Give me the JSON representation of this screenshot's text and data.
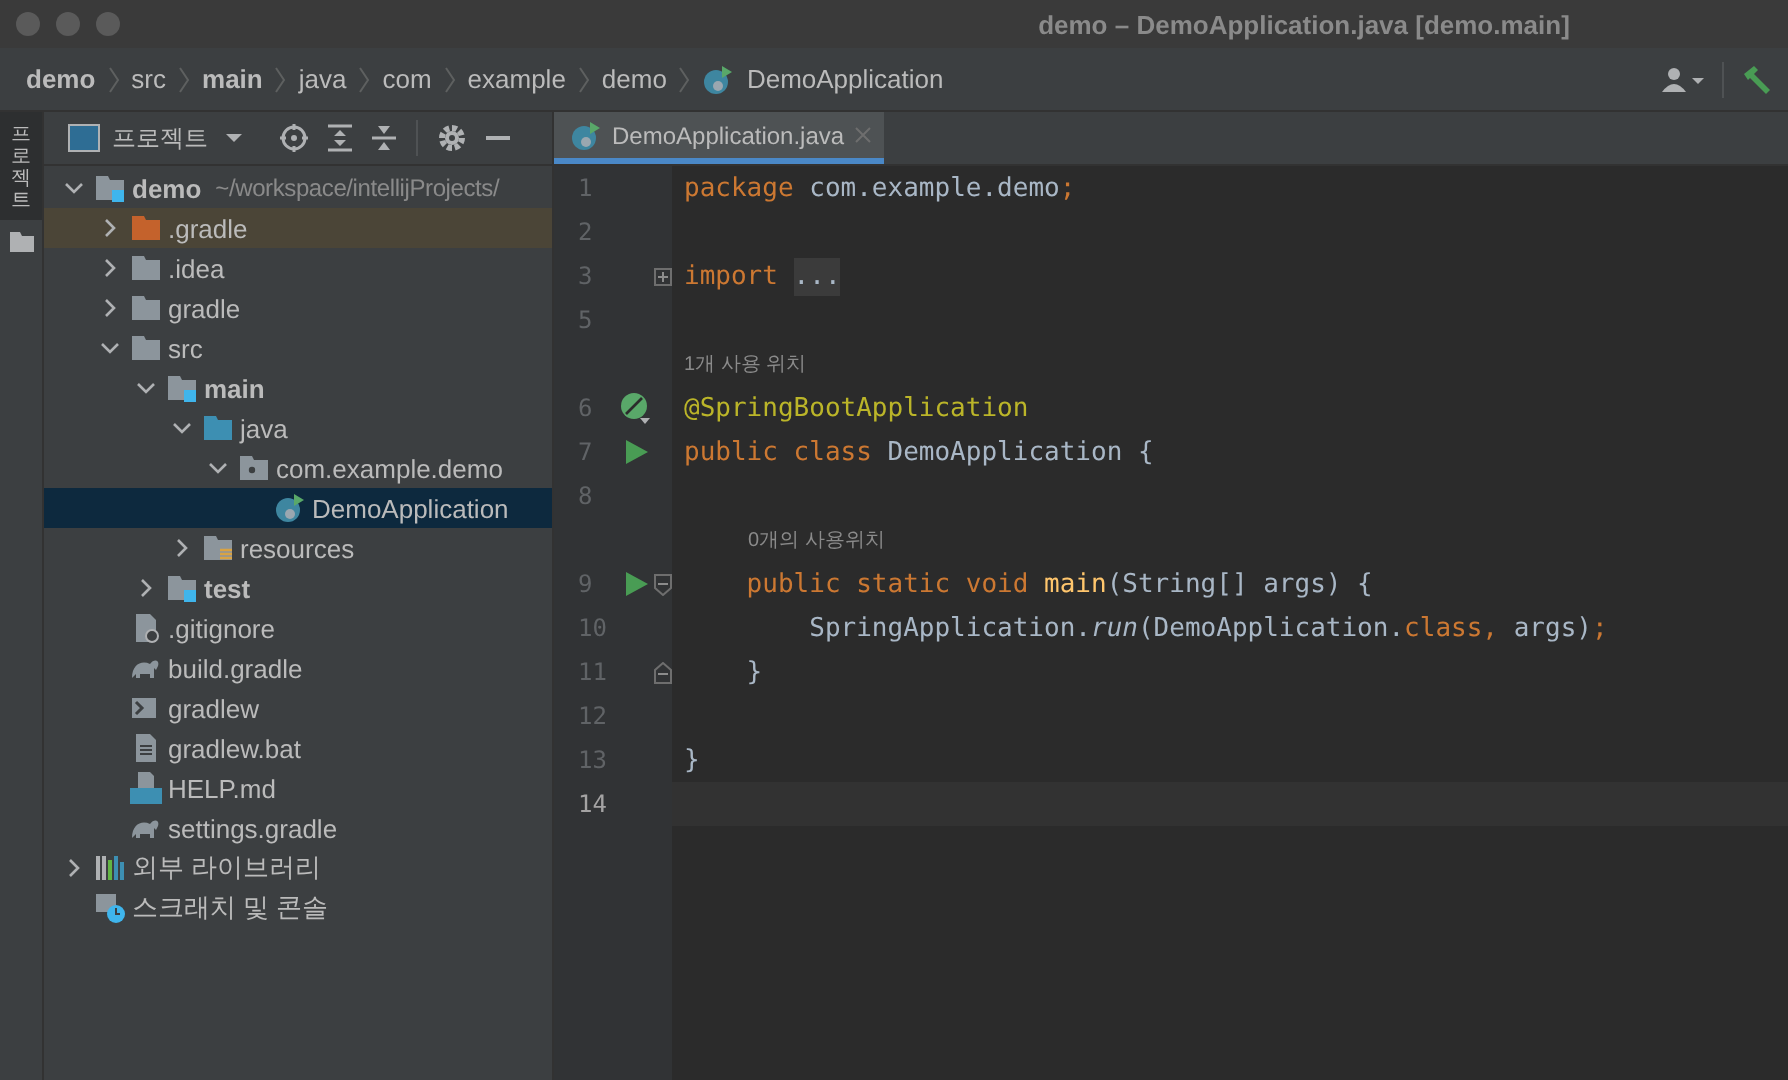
{
  "window": {
    "title": "demo – DemoApplication.java [demo.main]"
  },
  "breadcrumbs": [
    {
      "label": "demo",
      "bold": true,
      "kind": "directory"
    },
    {
      "label": "src",
      "bold": false,
      "kind": "directory"
    },
    {
      "label": "main",
      "bold": true,
      "kind": "directory"
    },
    {
      "label": "java",
      "bold": false,
      "kind": "directory"
    },
    {
      "label": "com",
      "bold": false,
      "kind": "directory"
    },
    {
      "label": "example",
      "bold": false,
      "kind": "directory"
    },
    {
      "label": "demo",
      "bold": false,
      "kind": "directory"
    },
    {
      "label": "DemoApplication",
      "bold": false,
      "kind": "spring-class"
    }
  ],
  "side_tab": {
    "label": "프로젝트",
    "selected": true
  },
  "project_toolbar": {
    "view": "프로젝트"
  },
  "tree": [
    {
      "label": "demo",
      "hint": "~/workspace/intellijProjects/",
      "kind": "folder-module",
      "bold": true,
      "expanded": true,
      "selected": false,
      "children": [
        {
          "label": ".gradle",
          "kind": "folder-excluded",
          "bold": false,
          "expanded": false,
          "selected": false
        },
        {
          "label": ".idea",
          "kind": "folder",
          "bold": false,
          "expanded": false,
          "selected": false
        },
        {
          "label": "gradle",
          "kind": "folder",
          "bold": false,
          "expanded": false,
          "selected": false
        },
        {
          "label": "src",
          "kind": "folder",
          "bold": false,
          "expanded": true,
          "selected": false,
          "children": [
            {
              "label": "main",
              "kind": "folder-module",
              "bold": true,
              "expanded": true,
              "selected": false,
              "children": [
                {
                  "label": "java",
                  "kind": "folder-source",
                  "bold": false,
                  "expanded": true,
                  "selected": false,
                  "children": [
                    {
                      "label": "com.example.demo",
                      "kind": "package",
                      "bold": false,
                      "expanded": true,
                      "selected": false,
                      "children": [
                        {
                          "label": "DemoApplication",
                          "kind": "spring-class",
                          "bold": false,
                          "selected": true
                        }
                      ]
                    }
                  ]
                },
                {
                  "label": "resources",
                  "kind": "folder-resources",
                  "bold": false,
                  "expanded": false,
                  "selected": false
                }
              ]
            },
            {
              "label": "test",
              "kind": "folder-module",
              "bold": true,
              "expanded": false,
              "selected": false
            }
          ]
        },
        {
          "label": ".gitignore",
          "kind": "file-ignore",
          "bold": false,
          "selected": false
        },
        {
          "label": "build.gradle",
          "kind": "gradle",
          "bold": false,
          "selected": false
        },
        {
          "label": "gradlew",
          "kind": "shell",
          "bold": false,
          "selected": false
        },
        {
          "label": "gradlew.bat",
          "kind": "text-file",
          "bold": false,
          "selected": false
        },
        {
          "label": "HELP.md",
          "kind": "markdown",
          "bold": false,
          "selected": false
        },
        {
          "label": "settings.gradle",
          "kind": "gradle",
          "bold": false,
          "selected": false
        }
      ]
    },
    {
      "label": "외부 라이브러리",
      "kind": "library",
      "bold": false,
      "expanded": false,
      "selected": false
    },
    {
      "label": "스크래치 및 콘솔",
      "kind": "scratch",
      "bold": false,
      "selected": false
    }
  ],
  "editor_tab": {
    "label": "DemoApplication.java",
    "selected": true,
    "kind": "spring-class"
  },
  "code": [
    {
      "kind": "code",
      "number": "1",
      "current": false,
      "tokens": [
        {
          "text": "package",
          "kind": "keyword"
        },
        {
          "text": " com.example.demo",
          "kind": "plain"
        },
        {
          "text": ";",
          "kind": "keyword"
        }
      ]
    },
    {
      "kind": "code",
      "number": "2",
      "current": false
    },
    {
      "kind": "code",
      "number": "3",
      "current": false,
      "gutter": [
        {
          "kind": "fold-collapsed"
        }
      ],
      "tokens": [
        {
          "text": "import ",
          "kind": "keyword"
        },
        {
          "text": "...",
          "kind": "folded"
        }
      ]
    },
    {
      "kind": "code",
      "number": "5",
      "current": false
    },
    {
      "kind": "hint",
      "text": "1개 사용 위치"
    },
    {
      "kind": "code",
      "number": "6",
      "current": false,
      "gutter": [
        {
          "kind": "bean"
        }
      ],
      "tokens": [
        {
          "text": "@SpringBootApplication",
          "kind": "annotation"
        }
      ]
    },
    {
      "kind": "code",
      "number": "7",
      "current": false,
      "gutter": [
        {
          "kind": "run"
        }
      ],
      "tokens": [
        {
          "text": "public class ",
          "kind": "keyword"
        },
        {
          "text": "DemoApplication {",
          "kind": "plain"
        }
      ]
    },
    {
      "kind": "code",
      "number": "8",
      "current": false
    },
    {
      "kind": "hint",
      "text": "0개의 사용위치"
    },
    {
      "kind": "code",
      "number": "9",
      "current": false,
      "gutter": [
        {
          "kind": "run"
        },
        {
          "kind": "fold-start"
        }
      ],
      "tokens": [
        {
          "text": "    public static void ",
          "kind": "keyword"
        },
        {
          "text": "main",
          "kind": "method"
        },
        {
          "text": "(String[] args) {",
          "kind": "plain"
        }
      ]
    },
    {
      "kind": "code",
      "number": "10",
      "current": false,
      "tokens": [
        {
          "text": "        SpringApplication.",
          "kind": "plain"
        },
        {
          "text": "run",
          "kind": "italic"
        },
        {
          "text": "(DemoApplication.",
          "kind": "plain"
        },
        {
          "text": "class, ",
          "kind": "keyword"
        },
        {
          "text": "args)",
          "kind": "plain"
        },
        {
          "text": ";",
          "kind": "keyword"
        }
      ]
    },
    {
      "kind": "code",
      "number": "11",
      "current": false,
      "gutter": [
        {
          "kind": "fold-end"
        }
      ],
      "tokens": [
        {
          "text": "    }",
          "kind": "plain"
        }
      ]
    },
    {
      "kind": "code",
      "number": "12",
      "current": false
    },
    {
      "kind": "code",
      "number": "13",
      "current": false,
      "tokens": [
        {
          "text": "}",
          "kind": "plain"
        }
      ]
    },
    {
      "kind": "code",
      "number": "14",
      "current": true
    }
  ]
}
